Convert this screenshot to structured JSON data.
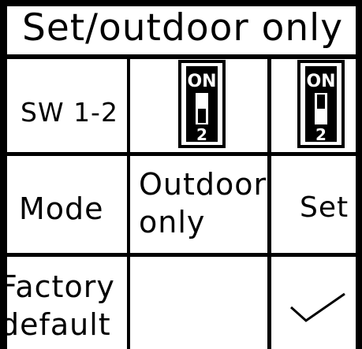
{
  "table": {
    "title": "Set/outdoor only",
    "rows": {
      "switch": {
        "label": "SW 1-2",
        "switch_outdoor": {
          "top_text": "ON",
          "bottom_text": "2",
          "position": "down"
        },
        "switch_set": {
          "top_text": "ON",
          "bottom_text": "2",
          "position": "up"
        }
      },
      "mode": {
        "label": "Mode",
        "outdoor_value": "Outdoor\nonly",
        "set_value": "Set"
      },
      "factory_default": {
        "label": "Factory\ndefault",
        "set_value_icon": "checkmark-icon"
      }
    }
  },
  "colors": {
    "line": "#000000",
    "background": "#ffffff"
  }
}
